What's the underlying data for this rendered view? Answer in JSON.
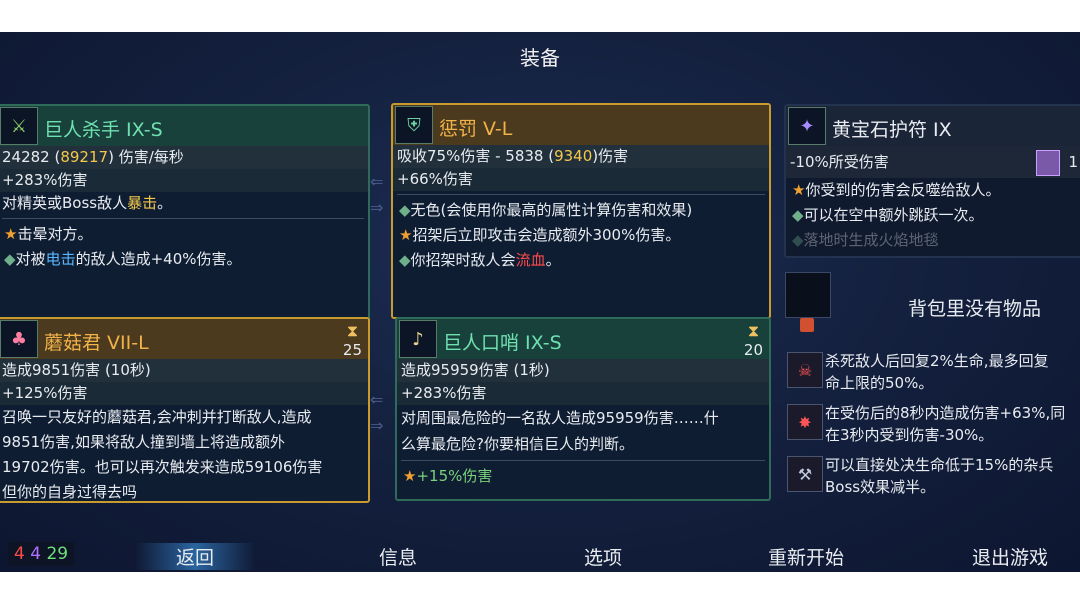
{
  "title": "装备",
  "arrows": {
    "left": "⇐",
    "right": "⇒"
  },
  "cards": {
    "giant_killer": {
      "icon": "sword-icon",
      "name": "巨人杀手 IX-S",
      "dps": "24282",
      "dps_crit": "89217",
      "dps_unit": "伤害/每秒",
      "bonus": "+283%伤害",
      "desc_a": "对精英或Boss敌人",
      "desc_crit": "暴击",
      "desc_b": "。",
      "skill1": "击晕对方。",
      "skill2_a": "对被",
      "skill2_hl": "电击",
      "skill2_b": "的敌人造成+40%伤害。"
    },
    "punishment": {
      "icon": "shield-icon",
      "name": "惩罚 V-L",
      "stat_a": "吸收75%伤害 - 5838 (",
      "stat_hl": "9340",
      "stat_b": ")伤害",
      "bonus": "+66%伤害",
      "skill1": "无色(会使用你最高的属性计算伤害和效果)",
      "skill2": "招架后立即攻击会造成额外300%伤害。",
      "skill3_a": "你招架时敌人会",
      "skill3_hl": "流血",
      "skill3_b": "。"
    },
    "topaz": {
      "icon": "amulet-icon",
      "name": "黄宝石护符 IX",
      "stat": "-10%所受伤害",
      "scroll_count": "1",
      "skill1": "你受到的伤害会反噬给敌人。",
      "skill2": "可以在空中额外跳跃一次。",
      "skill3": "落地时生成火焰地毯"
    },
    "mushroom": {
      "icon": "mushroom-icon",
      "name": "蘑菇君 VII-L",
      "cooldown": "25",
      "stat": "造成9851伤害 (10秒)",
      "bonus": "+125%伤害",
      "desc1": "召唤一只友好的蘑菇君,会冲刺并打断敌人,造成",
      "desc2": "9851伤害,如果将敌人撞到墙上将造成额外",
      "desc3": "19702伤害。也可以再次触发来造成59106伤害",
      "desc4": "但你的自身过得去吗"
    },
    "whistle": {
      "icon": "whistle-icon",
      "name": "巨人口哨 IX-S",
      "cooldown": "20",
      "stat": "造成95959伤害 (1秒)",
      "bonus": "+283%伤害",
      "desc1": "对周围最危险的一名敌人造成95959伤害……什",
      "desc2": "么算最危险?你要相信巨人的判断。",
      "skill1": "+15%伤害"
    }
  },
  "bag": {
    "empty_text": "背包里没有物品"
  },
  "perks": [
    {
      "icon": "vampire-icon",
      "line1": "杀死敌人后回复2%生命,最多回复",
      "line2": "命上限的50%。"
    },
    {
      "icon": "wound-icon",
      "line1": "在受伤后的8秒内造成伤害+63%,同",
      "line2": "在3秒内受到伤害-30%。"
    },
    {
      "icon": "executioner-icon",
      "line1": "可以直接处决生命低于15%的杂兵",
      "line2": "Boss效果减半。"
    }
  ],
  "counts": {
    "red": "4",
    "purple": "4",
    "green": "29"
  },
  "menu": {
    "back": "返回",
    "info": "信息",
    "options": "选项",
    "restart": "重新开始",
    "quit": "退出游戏"
  },
  "colors": {
    "accent_gold": "#c99a2e",
    "accent_green": "#2e6b58",
    "brutality": "#ff4a4a",
    "tactics": "#b070ff",
    "survival": "#6fe07a"
  }
}
